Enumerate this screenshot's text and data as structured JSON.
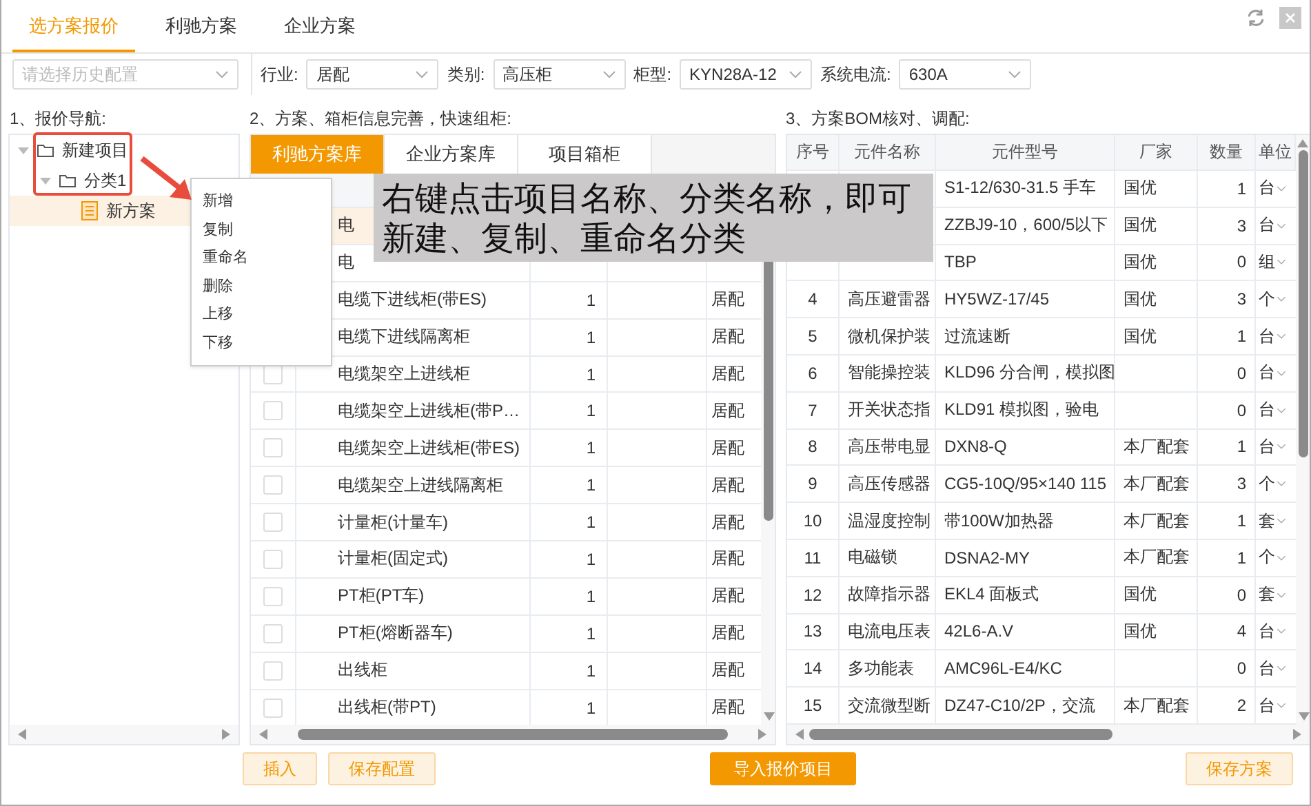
{
  "top_tabs": [
    {
      "label": "选方案报价",
      "selected": true
    },
    {
      "label": "利驰方案",
      "selected": false
    },
    {
      "label": "企业方案",
      "selected": false
    }
  ],
  "filters": {
    "history": {
      "placeholder": "请选择历史配置"
    },
    "fields": [
      {
        "label": "行业:",
        "value": "居配"
      },
      {
        "label": "类别:",
        "value": "高压柜"
      },
      {
        "label": "柜型:",
        "value": "KYN28A-12"
      },
      {
        "label": "系统电流:",
        "value": "630A"
      }
    ]
  },
  "sections": [
    "1、报价导航:",
    "2、方案、箱柜信息完善，快速组柜:",
    "3、方案BOM核对、调配:"
  ],
  "tree": [
    {
      "label": "新建项目",
      "kind": "folder",
      "expanded": true,
      "selected": false,
      "children": [
        {
          "label": "分类1",
          "kind": "folder",
          "expanded": true,
          "selected": false,
          "children": [
            {
              "label": "新方案",
              "kind": "scheme",
              "selected": true
            }
          ]
        }
      ]
    }
  ],
  "context_menu": [
    "新增",
    "复制",
    "重命名",
    "删除",
    "上移",
    "下移"
  ],
  "hint": "右键点击项目名称、分类名称，即可新建、复制、重命名分类",
  "library": {
    "tabs": [
      {
        "label": "利驰方案库",
        "selected": true
      },
      {
        "label": "企业方案库",
        "selected": false
      },
      {
        "label": "项目箱柜",
        "selected": false
      }
    ],
    "rows": [
      {
        "name": "电",
        "selected": true
      },
      {
        "name": "电",
        "selected": false
      },
      {
        "name": "电缆下进线柜(带ES)",
        "qty": "1",
        "column_5": "居配",
        "selected": false
      },
      {
        "name": "电缆下进线隔离柜",
        "qty": "1",
        "column_5": "居配",
        "selected": false
      },
      {
        "checked": false,
        "name": "电缆架空上进线柜",
        "qty": "1",
        "column_5": "居配",
        "selected": false
      },
      {
        "checked": false,
        "name": "电缆架空上进线柜(带P…",
        "qty": "1",
        "column_5": "居配",
        "selected": false
      },
      {
        "checked": false,
        "name": "电缆架空上进线柜(带ES)",
        "qty": "1",
        "column_5": "居配",
        "selected": false
      },
      {
        "checked": false,
        "name": "电缆架空上进线隔离柜",
        "qty": "1",
        "column_5": "居配",
        "selected": false
      },
      {
        "checked": false,
        "name": "计量柜(计量车)",
        "qty": "1",
        "column_5": "居配",
        "selected": false
      },
      {
        "checked": false,
        "name": "计量柜(固定式)",
        "qty": "1",
        "column_5": "居配",
        "selected": false
      },
      {
        "checked": false,
        "name": "PT柜(PT车)",
        "qty": "1",
        "column_5": "居配",
        "selected": false
      },
      {
        "checked": false,
        "name": "PT柜(熔断器车)",
        "qty": "1",
        "column_5": "居配",
        "selected": false
      },
      {
        "checked": false,
        "name": "出线柜",
        "qty": "1",
        "column_5": "居配",
        "selected": false
      },
      {
        "checked": false,
        "name": "出线柜(带PT)",
        "qty": "1",
        "column_5": "居配",
        "selected": false
      }
    ]
  },
  "bom": {
    "columns": [
      "序号",
      "元件名称",
      "元件型号",
      "厂家",
      "数量",
      "单位"
    ],
    "rows": [
      {
        "model": "S1-12/630-31.5 手车",
        "maker": "国优",
        "qty": "1",
        "unit": "台"
      },
      {
        "model": "ZZBJ9-10，600/5以下",
        "maker": "国优",
        "qty": "3",
        "unit": "台"
      },
      {
        "model": "TBP",
        "maker": "国优",
        "qty": "0",
        "unit": "组"
      },
      {
        "no": "4",
        "name": "高压避雷器",
        "model": "HY5WZ-17/45",
        "maker": "国优",
        "qty": "3",
        "unit": "个"
      },
      {
        "no": "5",
        "name": "微机保护装",
        "model": "过流速断",
        "maker": "国优",
        "qty": "1",
        "unit": "台"
      },
      {
        "no": "6",
        "name": "智能操控装",
        "model": "KLD96 分合闸，模拟图",
        "qty": "0",
        "unit": "台"
      },
      {
        "no": "7",
        "name": "开关状态指",
        "model": "KLD91 模拟图，验电",
        "qty": "0",
        "unit": "台"
      },
      {
        "no": "8",
        "name": "高压带电显",
        "model": "DXN8-Q",
        "maker": "本厂配套",
        "qty": "1",
        "unit": "台"
      },
      {
        "no": "9",
        "name": "高压传感器",
        "model": "CG5-10Q/95×140 115",
        "maker": "本厂配套",
        "qty": "3",
        "unit": "个"
      },
      {
        "no": "10",
        "name": "温湿度控制",
        "model": "带100W加热器",
        "maker": "本厂配套",
        "qty": "1",
        "unit": "套"
      },
      {
        "no": "11",
        "name": "电磁锁",
        "model": "DSNA2-MY",
        "maker": "本厂配套",
        "qty": "1",
        "unit": "个"
      },
      {
        "no": "12",
        "name": "故障指示器",
        "model": "EKL4  面板式",
        "maker": "国优",
        "qty": "0",
        "unit": "套"
      },
      {
        "no": "13",
        "name": "电流电压表",
        "model": "42L6-A.V",
        "maker": "国优",
        "qty": "4",
        "unit": "台"
      },
      {
        "no": "14",
        "name": "多功能表",
        "model": "AMC96L-E4/KC",
        "qty": "0",
        "unit": "台"
      },
      {
        "no": "15",
        "name": "交流微型断",
        "model": "DZ47-C10/2P，交流",
        "maker": "本厂配套",
        "qty": "2",
        "unit": "台"
      }
    ]
  },
  "buttons": [
    {
      "label": "插入",
      "kind": "light"
    },
    {
      "label": "保存配置",
      "kind": "light"
    },
    {
      "label": "导入报价项目",
      "kind": "solid"
    },
    {
      "label": "保存方案",
      "kind": "light"
    }
  ]
}
